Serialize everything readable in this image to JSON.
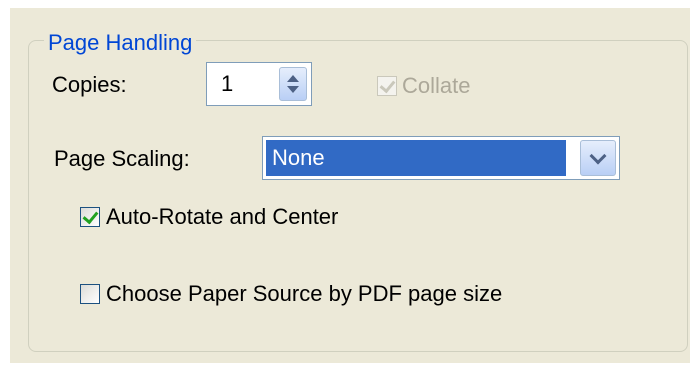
{
  "group": {
    "title": "Page Handling"
  },
  "copies": {
    "label": "Copies:",
    "value": "1"
  },
  "collate": {
    "label": "Collate",
    "checked": true,
    "disabled": true
  },
  "page_scaling": {
    "label": "Page Scaling:",
    "selected": "None"
  },
  "auto_rotate": {
    "label": "Auto-Rotate and Center",
    "checked": true
  },
  "paper_source": {
    "label": "Choose Paper Source by PDF page size",
    "checked": false
  },
  "colors": {
    "accent": "#0046d5",
    "selection": "#316ac5",
    "check": "#21a121",
    "panel": "#ece9d8"
  },
  "icons": {
    "spinner": "up-down-arrows-icon",
    "dropdown": "chevron-down-icon",
    "check": "checkmark-icon"
  }
}
